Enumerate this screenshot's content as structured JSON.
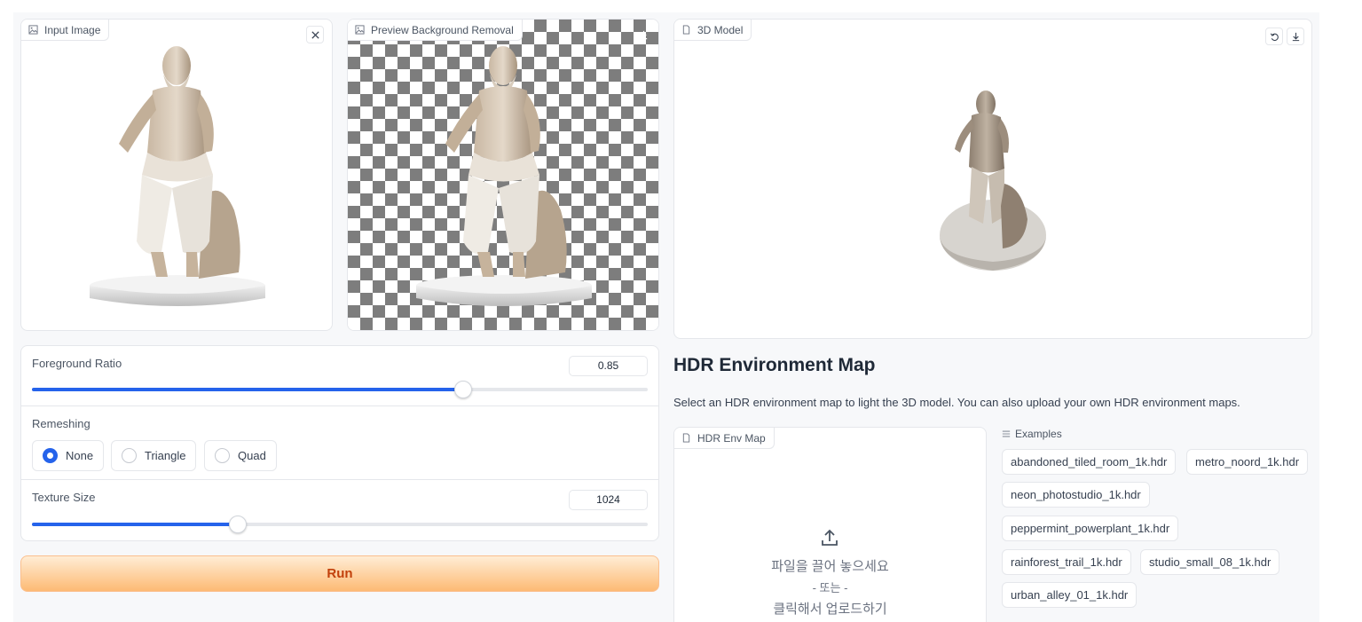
{
  "input_panel": {
    "label": "Input Image"
  },
  "preview_panel": {
    "label": "Preview Background Removal"
  },
  "model_panel": {
    "label": "3D Model"
  },
  "foreground_ratio": {
    "label": "Foreground Ratio",
    "value": "0.85",
    "fraction": 0.7
  },
  "remeshing": {
    "label": "Remeshing",
    "options": [
      "None",
      "Triangle",
      "Quad"
    ],
    "selected": "None"
  },
  "texture_size": {
    "label": "Texture Size",
    "value": "1024",
    "fraction": 0.335
  },
  "run_button": {
    "label": "Run"
  },
  "hdr": {
    "title": "HDR Environment Map",
    "description": "Select an HDR environment map to light the 3D model. You can also upload your own HDR environment maps.",
    "upload_label": "HDR Env Map",
    "drop_text": "파일을 끌어 놓으세요",
    "or_text": "- 또는 -",
    "click_text": "클릭해서 업로드하기"
  },
  "examples": {
    "label": "Examples",
    "items": [
      "abandoned_tiled_room_1k.hdr",
      "metro_noord_1k.hdr",
      "neon_photostudio_1k.hdr",
      "peppermint_powerplant_1k.hdr",
      "rainforest_trail_1k.hdr",
      "studio_small_08_1k.hdr",
      "urban_alley_01_1k.hdr"
    ]
  }
}
